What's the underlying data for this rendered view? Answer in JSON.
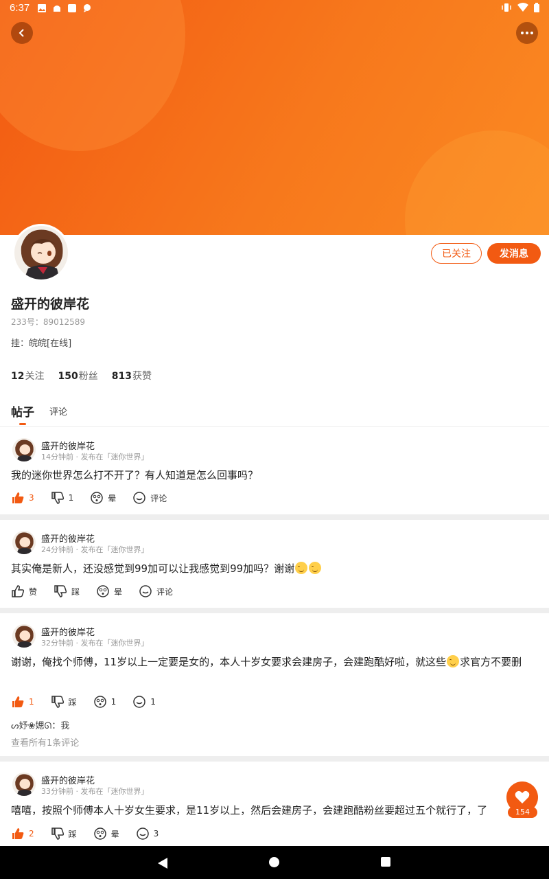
{
  "status_bar": {
    "time": "6:37"
  },
  "profile": {
    "name": "盛开的彼岸花",
    "uid": "233号：89012589",
    "bio": "挂：皖皖[在线]",
    "following_count": "12",
    "following_label": "关注",
    "fans_count": "150",
    "fans_label": "粉丝",
    "likes_count": "813",
    "likes_label": "获赞",
    "followed_button": "已关注",
    "message_button": "发消息"
  },
  "tabs": {
    "active": "帖子",
    "other": "评论"
  },
  "colors": {
    "accent": "#f25a12",
    "banner_end": "#fb8a22"
  },
  "posts": [
    {
      "author": "盛开的彼岸花",
      "meta": "14分钟前 · 发布在「迷你世界」",
      "text": "我的迷你世界怎么打不开了？有人知道是怎么回事吗？",
      "like": "3",
      "dislike": "1",
      "dizzy": "晕",
      "comment": "评论"
    },
    {
      "author": "盛开的彼岸花",
      "meta": "24分钟前 · 发布在「迷你世界」",
      "text": "其实俺是新人，还没感觉到99加可以让我感觉到99加吗？谢谢",
      "like": "赞",
      "dislike": "踩",
      "dizzy": "晕",
      "comment": "评论"
    },
    {
      "author": "盛开的彼岸花",
      "meta": "32分钟前 · 发布在「迷你世界」",
      "text_a": "谢谢，俺找个师傅，11岁以上一定要是女的，本人十岁女要求会建房子，会建跑酷好啦，就这些",
      "text_b": "求官方不要删",
      "like": "1",
      "dislike": "踩",
      "dizzy": "1",
      "comment": "1",
      "comment_author": "ᔕ妤❀媤ᘏ",
      "comment_text": "：我",
      "view_all": "查看所有1条评论"
    },
    {
      "author": "盛开的彼岸花",
      "meta": "33分钟前 · 发布在「迷你世界」",
      "text": "嘻嘻，按照个师傅本人十岁女生要求，是11岁以上，然后会建房子，会建跑酷粉丝要超过五个就行了，了",
      "like": "2",
      "dislike": "踩",
      "dizzy": "晕",
      "comment": "3"
    }
  ],
  "floating_like": {
    "count": "154",
    "icon": "heart-icon"
  }
}
